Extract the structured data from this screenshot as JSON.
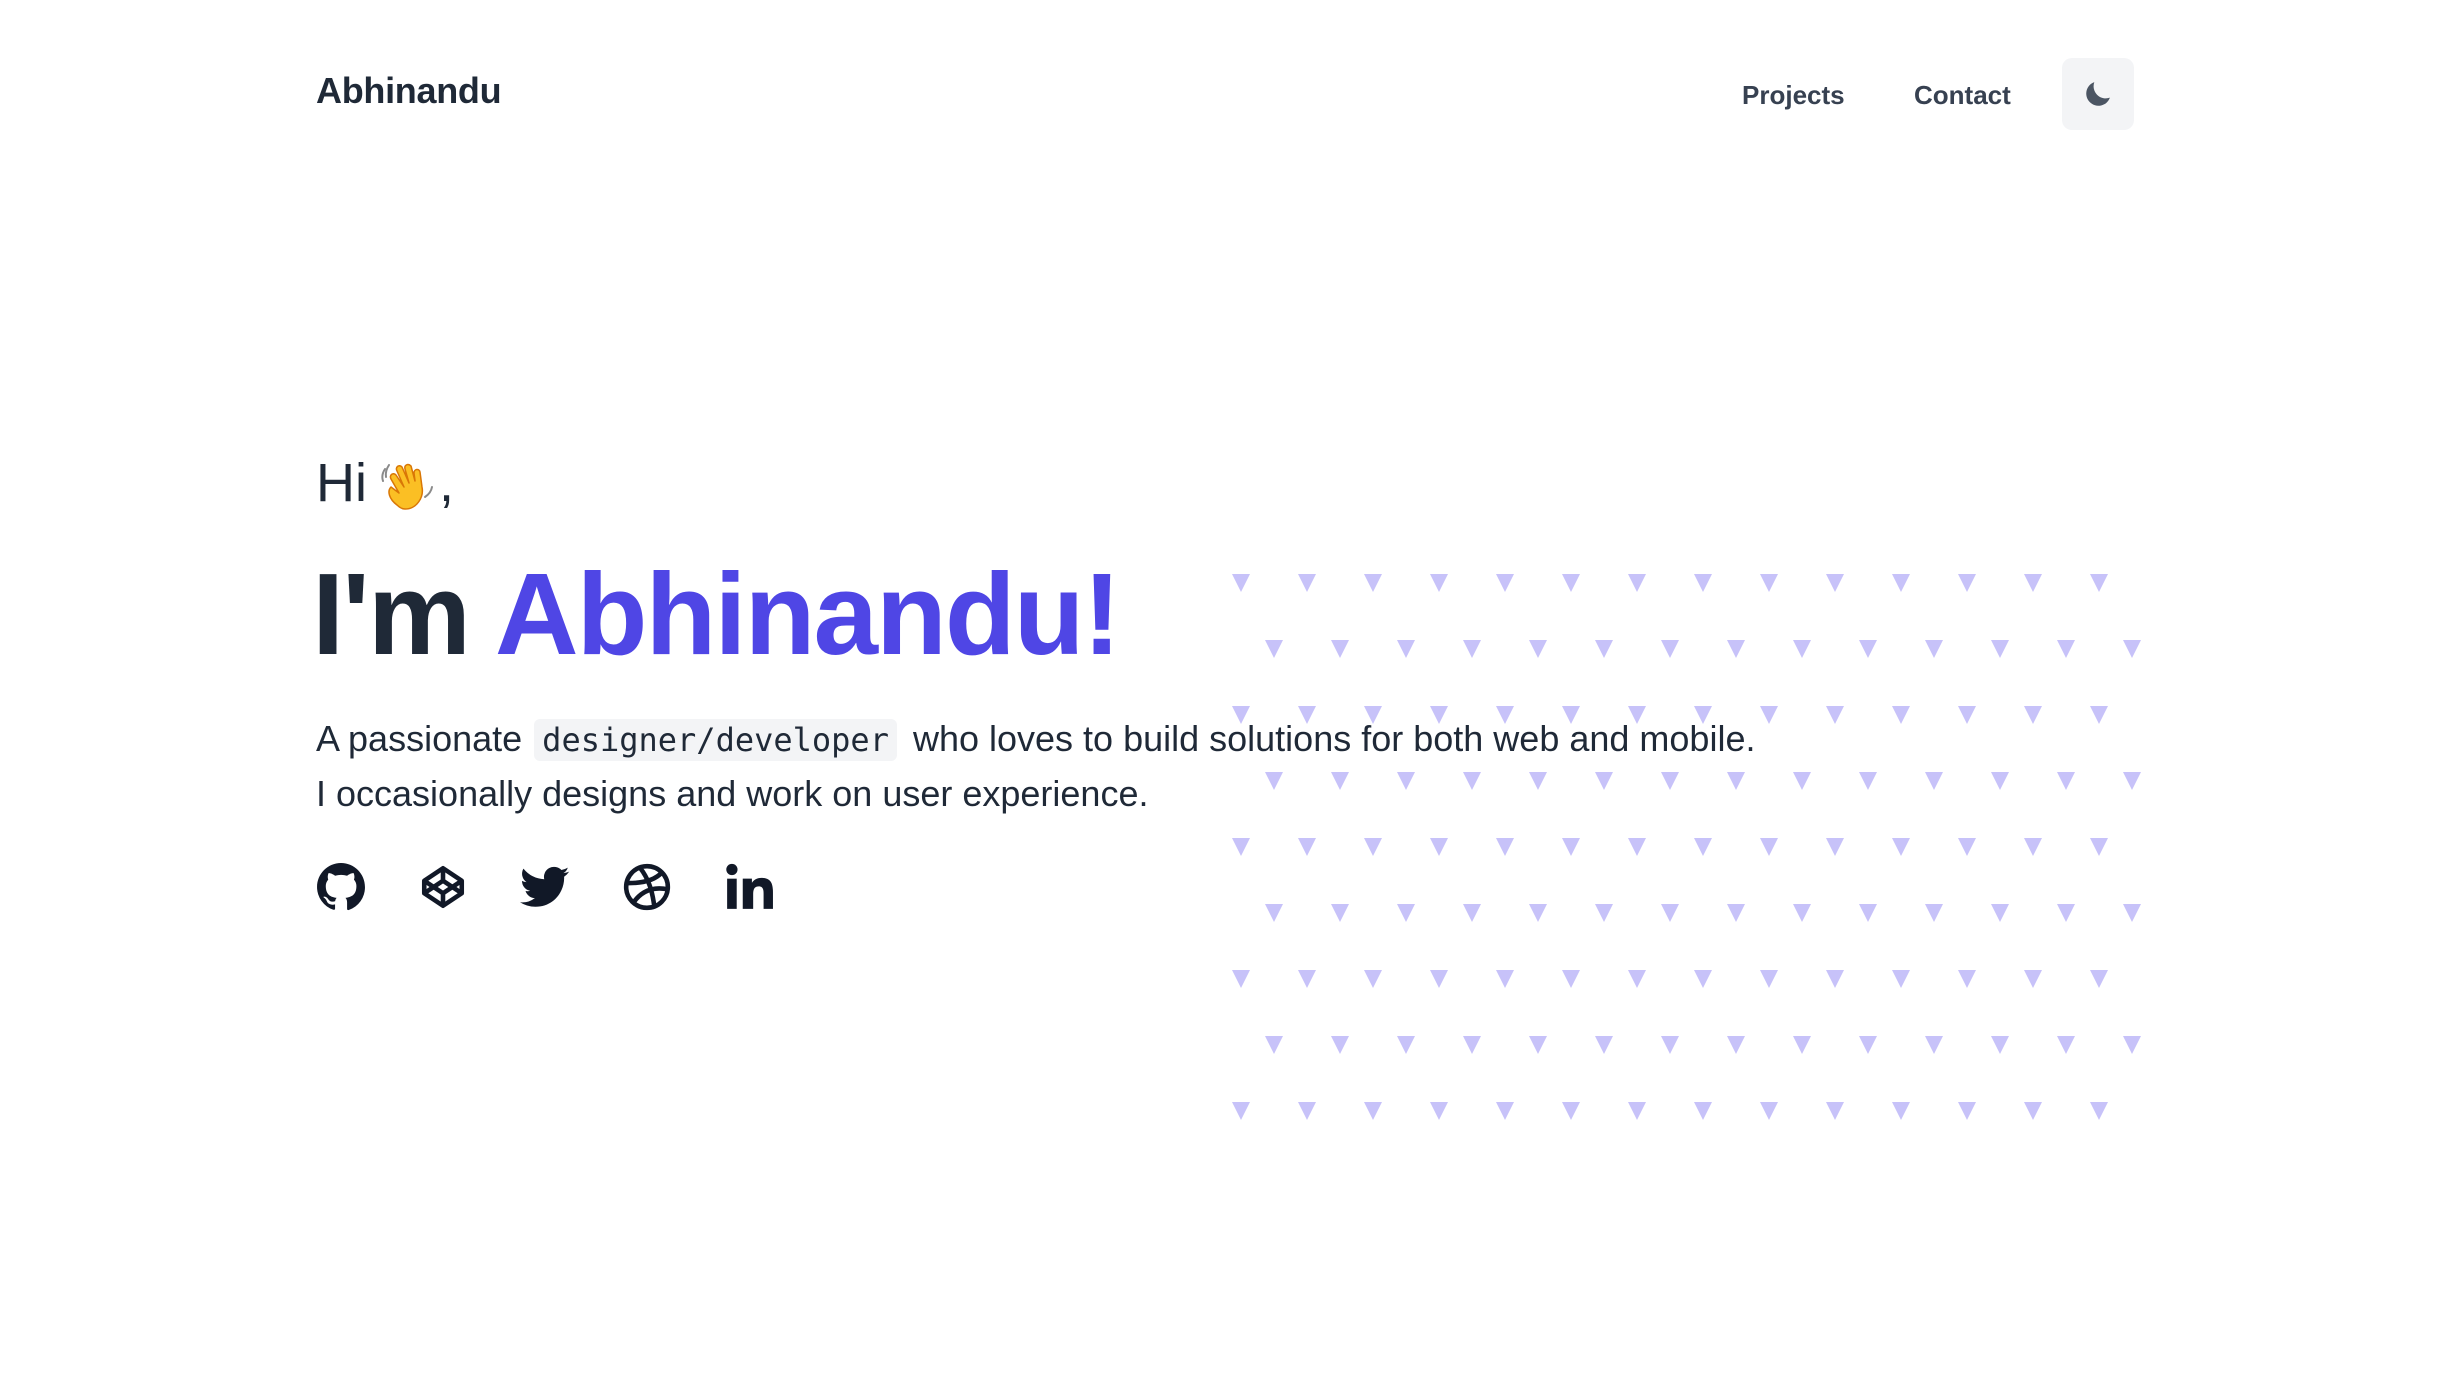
{
  "header": {
    "brand": "Abhinandu",
    "nav": [
      {
        "label": "Projects"
      },
      {
        "label": "Contact"
      }
    ],
    "theme_toggle_icon": "moon-icon"
  },
  "hero": {
    "greeting": "Hi",
    "greeting_icon": "waving-hand-icon",
    "greeting_suffix": ",",
    "headline_prefix": "I'm",
    "headline_name": "Abhinandu!",
    "intro_start": "A passionate",
    "intro_code": "designer/developer",
    "intro_end": "who loves to build solutions for both web and mobile.",
    "intro_line2": "I occasionally designs and work on user experience."
  },
  "socials": [
    {
      "name": "github-icon"
    },
    {
      "name": "codepen-icon"
    },
    {
      "name": "twitter-icon"
    },
    {
      "name": "dribbble-icon"
    },
    {
      "name": "linkedin-icon"
    }
  ],
  "colors": {
    "accent": "#4f46e5",
    "text": "#1f2937",
    "pattern": "#c7c2f9",
    "toggle_bg": "#f3f4f6"
  }
}
